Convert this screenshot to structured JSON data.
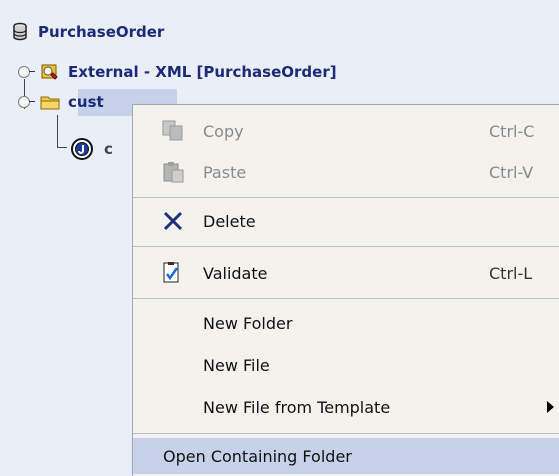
{
  "tree": {
    "root_label": "PurchaseOrder",
    "external_label": "External - XML [PurchaseOrder]",
    "folder_label": "cust",
    "child_label": "c"
  },
  "context_menu": {
    "copy": {
      "label": "Copy",
      "shortcut": "Ctrl-C"
    },
    "paste": {
      "label": "Paste",
      "shortcut": "Ctrl-V"
    },
    "delete": {
      "label": "Delete"
    },
    "validate": {
      "label": "Validate",
      "shortcut": "Ctrl-L"
    },
    "new_folder": {
      "label": "New Folder"
    },
    "new_file": {
      "label": "New File"
    },
    "new_file_template": {
      "label": "New File from Template"
    },
    "open_containing_folder": {
      "label": "Open Containing Folder"
    }
  },
  "icons": {
    "root": "database-icon",
    "external": "xml-schema-icon",
    "folder": "folder-icon",
    "child": "component-icon",
    "copy": "copy-icon",
    "paste": "paste-icon",
    "delete": "delete-x-icon",
    "validate": "validate-icon",
    "submenu": "submenu-arrow-icon"
  }
}
